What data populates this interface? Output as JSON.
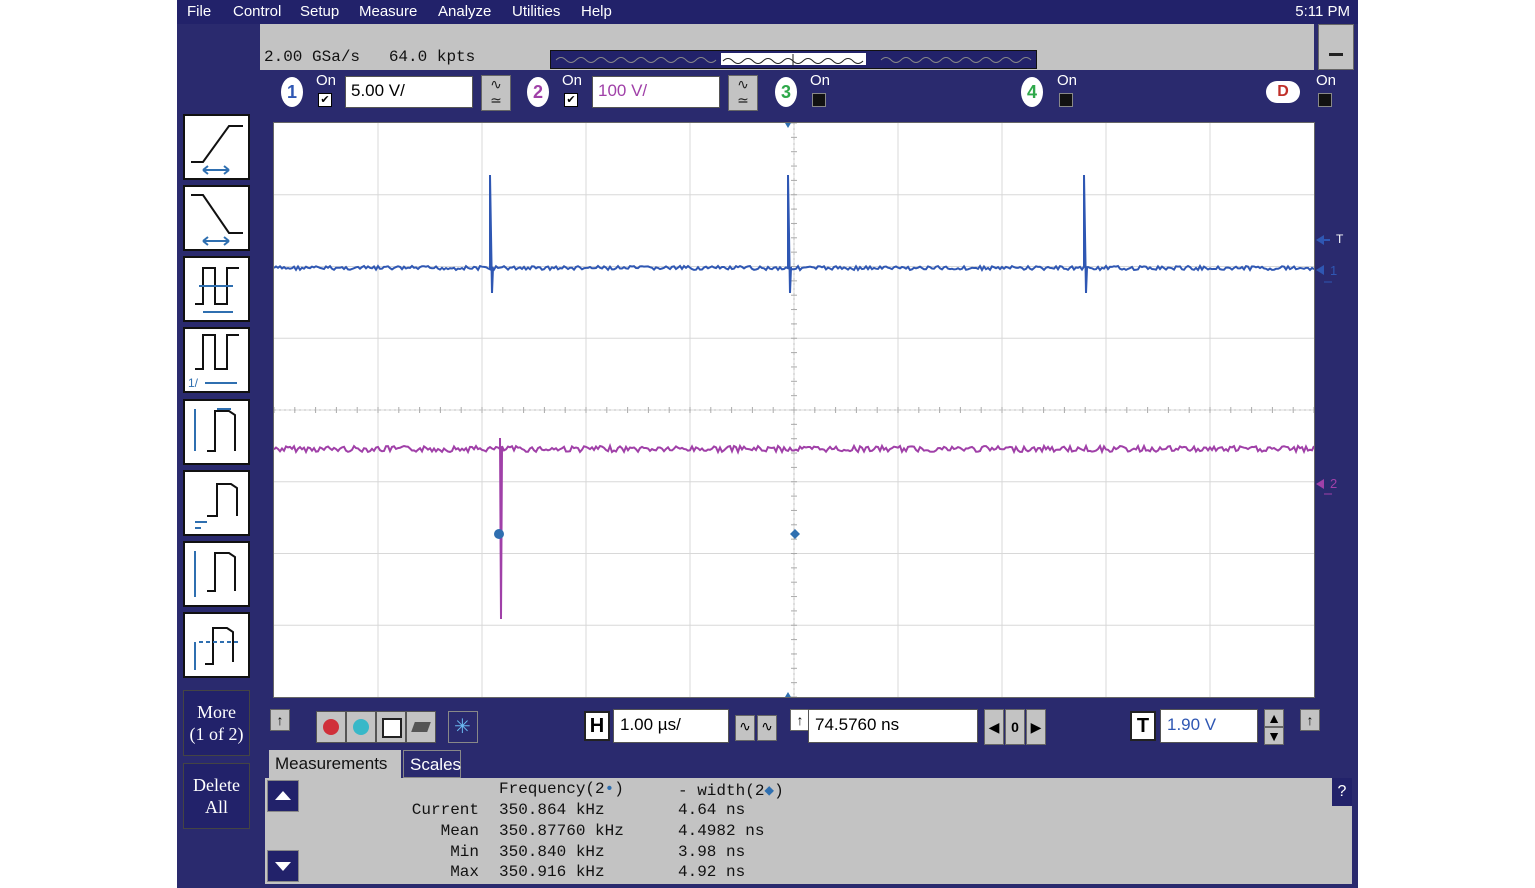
{
  "menu": {
    "items": [
      "File",
      "Control",
      "Setup",
      "Measure",
      "Analyze",
      "Utilities",
      "Help"
    ],
    "clock": "5:11 PM"
  },
  "acquisition": {
    "sample_rate": "2.00 GSa/s",
    "memory_depth": "64.0 kpts"
  },
  "channels": [
    {
      "num": "1",
      "on_label": "On",
      "checked": true,
      "scale": "5.00 V/",
      "color": "#2f57b3"
    },
    {
      "num": "2",
      "on_label": "On",
      "checked": true,
      "scale": "100 V/",
      "color": "#a040a8"
    },
    {
      "num": "3",
      "on_label": "On",
      "checked": false,
      "color": "#2ea84a"
    },
    {
      "num": "4",
      "on_label": "On",
      "checked": false,
      "color": "#2ea84a"
    },
    {
      "num": "D",
      "on_label": "On",
      "checked": false,
      "color": "#c0302a"
    }
  ],
  "side_buttons": {
    "more": "More",
    "more_page": "(1 of 2)",
    "delete": "Delete",
    "delete_sub": "All"
  },
  "markers": {
    "trigger": "T",
    "ch1": "1",
    "ch2": "2"
  },
  "timebase": {
    "h_label": "H",
    "scale": "1.00 µs/",
    "delay": "74.5760 ns",
    "ref": "0"
  },
  "trigger": {
    "t_label": "T",
    "level": "1.90 V"
  },
  "measurements": {
    "tabs": [
      "Measurements",
      "Scales"
    ],
    "col1_header": "Frequency(2",
    "col2_header": "- width(2",
    "rows": [
      {
        "label": "Current",
        "v1": "350.864 kHz",
        "v2": "4.64 ns"
      },
      {
        "label": "Mean",
        "v1": "350.87760 kHz",
        "v2": "4.4982 ns"
      },
      {
        "label": "Min",
        "v1": "350.840 kHz",
        "v2": "3.98 ns"
      },
      {
        "label": "Max",
        "v1": "350.916 kHz",
        "v2": "4.92 ns"
      }
    ],
    "help": "?"
  }
}
